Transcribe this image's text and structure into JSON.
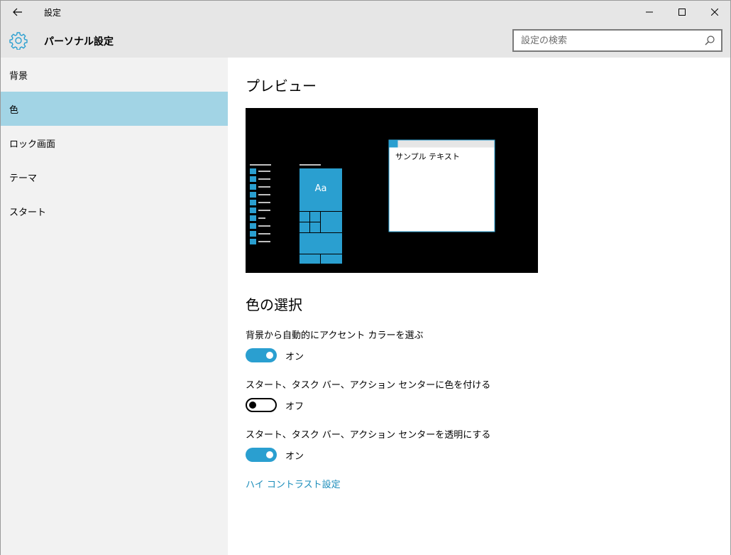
{
  "window": {
    "title": "設定",
    "back_icon": "arrow-left-icon",
    "controls": [
      "minimize-icon",
      "maximize-icon",
      "close-icon"
    ]
  },
  "header": {
    "icon": "gear-icon",
    "title": "パーソナル設定",
    "search": {
      "placeholder": "設定の検索",
      "value": "",
      "icon": "search-icon"
    }
  },
  "sidebar": {
    "items": [
      {
        "label": "背景",
        "active": false
      },
      {
        "label": "色",
        "active": true
      },
      {
        "label": "ロック画面",
        "active": false
      },
      {
        "label": "テーマ",
        "active": false
      },
      {
        "label": "スタート",
        "active": false
      }
    ]
  },
  "main": {
    "preview_heading": "プレビュー",
    "preview": {
      "tile_label": "Aa",
      "window_text": "サンプル テキスト",
      "accent_color": "#2a9fd0"
    },
    "color_heading": "色の選択",
    "settings": [
      {
        "label": "背景から自動的にアクセント カラーを選ぶ",
        "state": "オン",
        "on": true
      },
      {
        "label": "スタート、タスク バー、アクション センターに色を付ける",
        "state": "オフ",
        "on": false
      },
      {
        "label": "スタート、タスク バー、アクション センターを透明にする",
        "state": "オン",
        "on": true
      }
    ],
    "link": "ハイ コントラスト設定"
  },
  "colors": {
    "accent": "#2a9fd0",
    "selected_nav": "#a2d4e5",
    "link": "#1a8cba",
    "chrome": "#e6e6e6",
    "sidebar": "#f2f2f2"
  }
}
